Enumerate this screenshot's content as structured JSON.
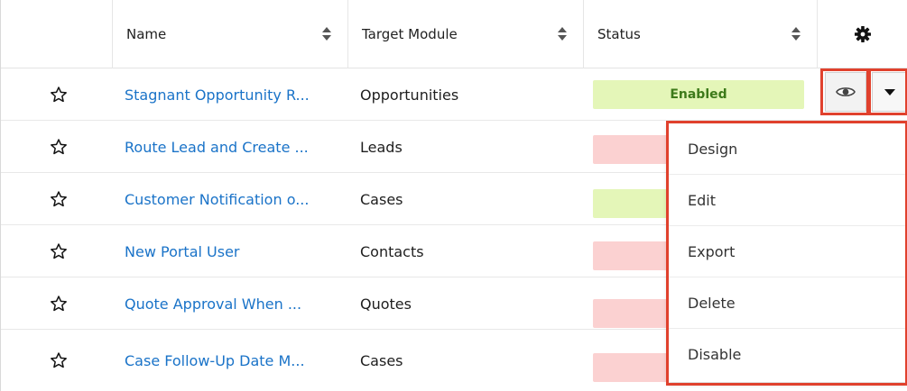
{
  "columns": {
    "name": "Name",
    "target_module": "Target Module",
    "status": "Status"
  },
  "icons": {
    "star": "star-outline-icon",
    "settings": "gear-icon",
    "preview": "eye-icon",
    "actions": "caret-down-icon",
    "sort": "sort-arrows-icon"
  },
  "rows": [
    {
      "name": "Stagnant Opportunity R...",
      "module": "Opportunities",
      "status": "Enabled"
    },
    {
      "name": "Route Lead and Create ...",
      "module": "Leads",
      "status": ""
    },
    {
      "name": "Customer Notification o...",
      "module": "Cases",
      "status": ""
    },
    {
      "name": "New Portal User",
      "module": "Contacts",
      "status": ""
    },
    {
      "name": "Quote Approval When ...",
      "module": "Quotes",
      "status": ""
    },
    {
      "name": "Case Follow-Up Date M...",
      "module": "Cases",
      "status": ""
    }
  ],
  "row_status_kind": [
    "enabled",
    "disabled",
    "enabled",
    "disabled",
    "disabled",
    "disabled"
  ],
  "menu": {
    "items": [
      "Design",
      "Edit",
      "Export",
      "Delete",
      "Disable"
    ]
  },
  "colors": {
    "link": "#1a73c8",
    "enabled_bg": "#e4f6b8",
    "enabled_text": "#3d7a1a",
    "disabled_bg": "#fbd1d1",
    "highlight": "#e0412d"
  }
}
